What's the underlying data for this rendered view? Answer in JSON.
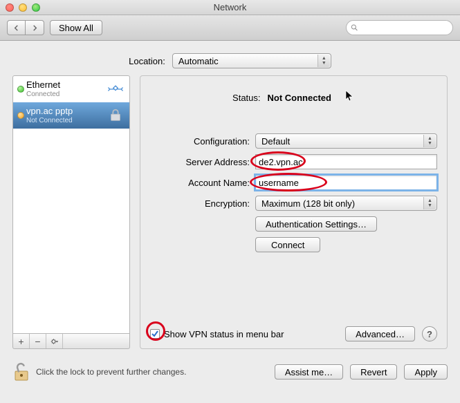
{
  "window": {
    "title": "Network"
  },
  "toolbar": {
    "show_all": "Show All",
    "search_placeholder": ""
  },
  "location": {
    "label": "Location:",
    "value": "Automatic"
  },
  "services": [
    {
      "name": "Ethernet",
      "status": "Connected",
      "status_color": "green",
      "type": "ethernet"
    },
    {
      "name": "vpn.ac pptp",
      "status": "Not Connected",
      "status_color": "orange",
      "type": "vpn"
    }
  ],
  "detail": {
    "status_label": "Status:",
    "status_value": "Not Connected",
    "configuration_label": "Configuration:",
    "configuration_value": "Default",
    "server_label": "Server Address:",
    "server_value": "de2.vpn.ac",
    "account_label": "Account Name:",
    "account_value": "username",
    "encryption_label": "Encryption:",
    "encryption_value": "Maximum (128 bit only)",
    "auth_button": "Authentication Settings…",
    "connect_button": "Connect",
    "show_status_checkbox": true,
    "show_status_label": "Show VPN status in menu bar",
    "advanced_button": "Advanced…",
    "help_button": "?"
  },
  "footer": {
    "lock_text": "Click the lock to prevent further changes.",
    "assist": "Assist me…",
    "revert": "Revert",
    "apply": "Apply"
  }
}
